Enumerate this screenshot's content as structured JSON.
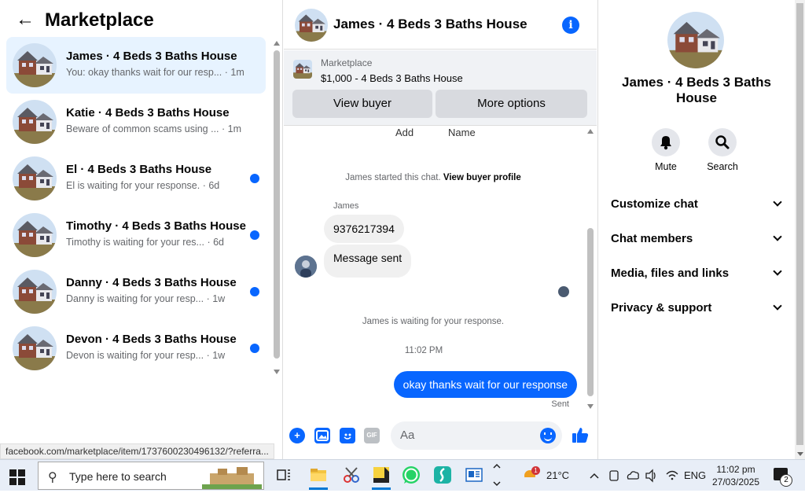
{
  "marketplace": {
    "title": "Marketplace",
    "conversations": [
      {
        "name": "James · 4 Beds 3 Baths House",
        "preview": "You: okay thanks wait for our resp...",
        "time": "· 1m",
        "unread": false,
        "active": true
      },
      {
        "name": "Katie · 4 Beds 3 Baths House",
        "preview": "Beware of common scams using ...",
        "time": "· 1m",
        "unread": false,
        "active": false
      },
      {
        "name": "El · 4 Beds 3 Baths House",
        "preview": "El is waiting for your response.",
        "time": "· 6d",
        "unread": true,
        "active": false
      },
      {
        "name": "Timothy · 4 Beds 3 Baths House",
        "preview": "Timothy is waiting for your res...",
        "time": "· 6d",
        "unread": true,
        "active": false
      },
      {
        "name": "Danny · 4 Beds 3 Baths House",
        "preview": "Danny is waiting for your resp...",
        "time": "· 1w",
        "unread": true,
        "active": false
      },
      {
        "name": "Devon · 4 Beds 3 Baths House",
        "preview": "Devon is waiting for your resp...",
        "time": "· 1w",
        "unread": true,
        "active": false
      }
    ]
  },
  "status_url": "facebook.com/marketplace/item/1737600230496132/?referra...",
  "chat": {
    "title": "James · 4 Beds 3 Baths House",
    "listing_label": "Marketplace",
    "listing_title": "$1,000 - 4 Beds 3 Baths House",
    "view_buyer": "View buyer",
    "more_options": "More options",
    "cut_add": "Add",
    "cut_name": "Name",
    "started_text": "James started this chat.",
    "view_profile": "View buyer profile",
    "sender": "James",
    "msg1": "9376217394",
    "msg2": "Message sent",
    "waiting": "James is waiting for your response.",
    "timestamp": "11:02 PM",
    "my_msg": "okay thanks wait for our response",
    "sent": "Sent",
    "composer_placeholder": "Aa",
    "gif_label": "GIF"
  },
  "details": {
    "title": "James · 4 Beds 3 Baths House",
    "mute": "Mute",
    "search": "Search",
    "sections": [
      "Customize chat",
      "Chat members",
      "Media, files and links",
      "Privacy & support"
    ]
  },
  "taskbar": {
    "search_placeholder": "Type here to search",
    "weather_badge": "1",
    "temperature": "21°C",
    "language": "ENG",
    "time": "11:02 pm",
    "date": "27/03/2025",
    "notification_count": "2"
  },
  "colors": {
    "accent": "#0866ff",
    "active_bg": "#e7f3ff"
  }
}
